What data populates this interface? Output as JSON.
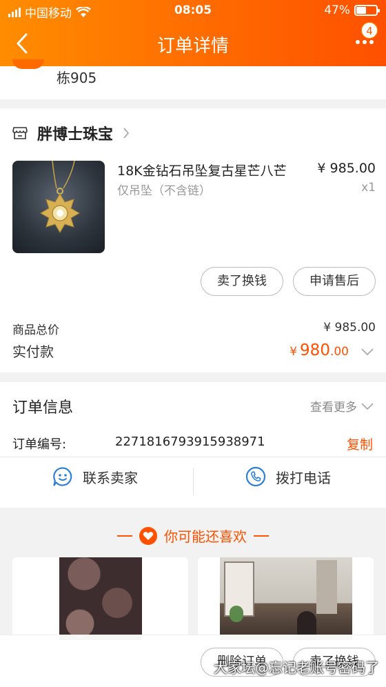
{
  "status_bar": {
    "carrier": "中国移动",
    "time": "08:05",
    "battery": "47%"
  },
  "nav": {
    "title": "订单详情",
    "badge": "4"
  },
  "address": {
    "text": "栋905"
  },
  "shop": {
    "name": "胖博士珠宝",
    "product": {
      "title": "18K金钻石吊坠复古星芒八芒",
      "spec": "仅吊坠（不含链）",
      "price": "¥ 985.00",
      "qty": "x1"
    },
    "actions": {
      "sell": "卖了换钱",
      "after_sale": "申请售后"
    },
    "summary": {
      "total_label": "商品总价",
      "total_value": "¥ 985.00",
      "paid_label": "实付款",
      "paid_symbol": "¥",
      "paid_int": "980",
      "paid_dec": ".00"
    }
  },
  "order_info": {
    "title": "订单信息",
    "more": "查看更多",
    "number_label": "订单编号:",
    "number_value": "2271816793915938971",
    "copy": "复制",
    "contact_seller": "联系卖家",
    "call": "拨打电话"
  },
  "recommend": {
    "title": "你可能还喜欢"
  },
  "bottom": {
    "delete": "删除订单",
    "sell": "卖了换钱"
  },
  "watermark": "大家坛@忘记老账号密码了",
  "colors": {
    "accent": "#ff5000",
    "header_start": "#ff8d00",
    "contact_icon": "#2e7fd9"
  }
}
